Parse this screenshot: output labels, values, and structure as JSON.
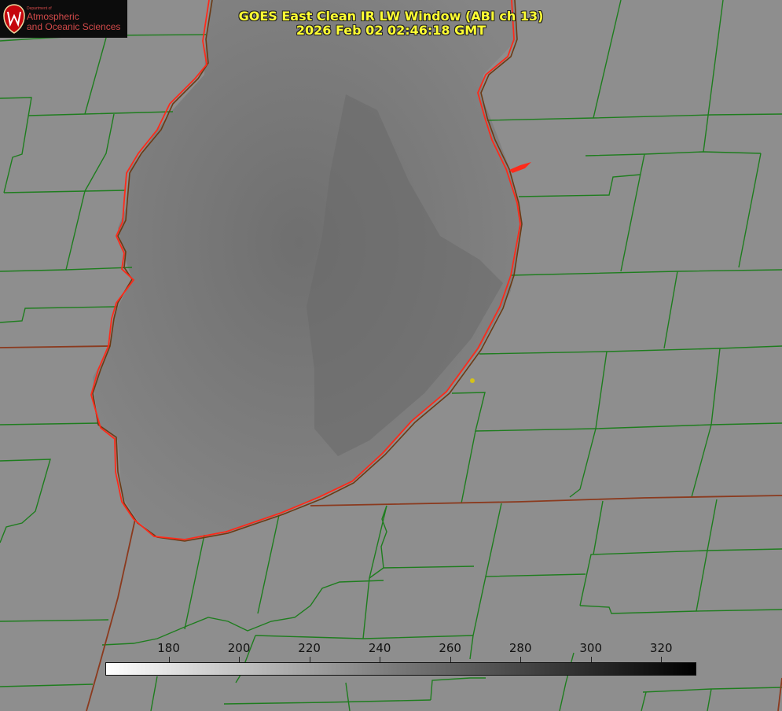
{
  "logo": {
    "department": "Department of",
    "line1": "Atmospheric",
    "line2": "and Oceanic Sciences",
    "icon": "uw-crest-icon"
  },
  "title": {
    "line1": "GOES East Clean IR LW Window (ABI ch 13)",
    "line2": "2026 Feb 02 02:46:18 GMT"
  },
  "colorbar": {
    "ticks": [
      "180",
      "200",
      "220",
      "240",
      "260",
      "280",
      "300",
      "320"
    ],
    "min": 162,
    "max": 330,
    "gradient": [
      "#ffffff",
      "#000000"
    ]
  },
  "colors": {
    "county_lines": "#1e7d1e",
    "state_lines": "#8b3a1e",
    "lake_outline": "#ff2a1a",
    "marker": "#d4c21a",
    "title": "#ffff33"
  }
}
